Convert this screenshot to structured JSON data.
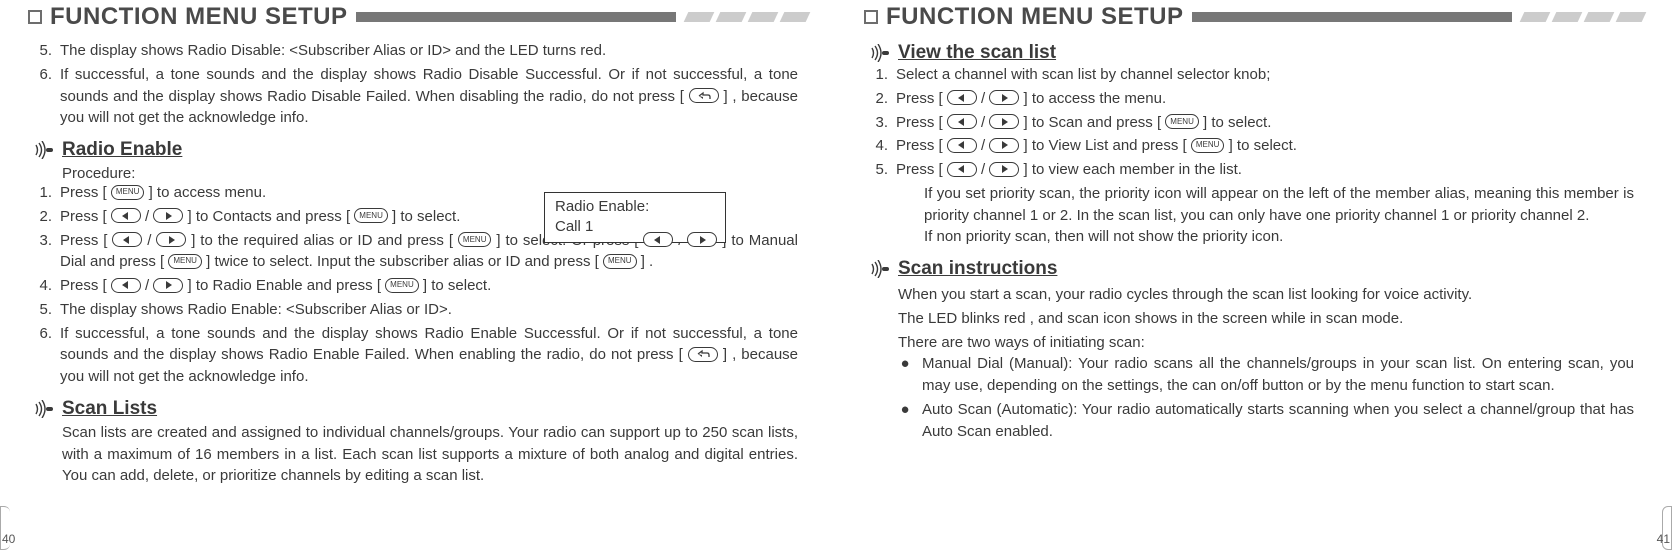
{
  "left": {
    "header_title": "FUNCTION MENU SETUP",
    "intro_items": [
      "The display shows Radio Disable: <Subscriber Alias or ID> and the LED turns red.",
      "If successful, a tone sounds and the display shows Radio Disable Successful. Or if not successful, a tone sounds and the display shows Radio Disable Failed. When disabling the radio, do not press [ {BACK} ] , because you will not get the acknowledge info."
    ],
    "intro_start": 5,
    "section1_title": "Radio Enable",
    "procedure_label": "Procedure:",
    "callout_line1": "Radio Enable:",
    "callout_line2": "Call 1",
    "proc_items": [
      "Press [ {MENU} ] to access menu.",
      "Press [ {LEFT} / {RIGHT} ] to Contacts and press [ {MENU} ]  to select.",
      "Press [ {LEFT} / {RIGHT} ] to the required alias or ID and press [ {MENU} ]  to select. Or press [ {LEFT} / {RIGHT} ] to Manual Dial and press [ {MENU} ] twice to select. Input  the subscriber alias or ID and press [ {MENU} ] .",
      "Press [ {LEFT} / {RIGHT} ] to Radio Enable and press [ {MENU} ] to select.",
      "The display shows Radio Enable: <Subscriber Alias or ID>.",
      "If successful, a tone sounds and the display shows Radio Enable Successful. Or if not successful, a tone sounds and the display shows Radio Enable Failed. When enabling the radio, do not press [ {BACK} ] , because you will not get the acknowledge info."
    ],
    "section2_title": "Scan Lists",
    "scan_lists_para": "Scan lists are created and assigned to individual channels/groups. Your radio can support up to 250 scan lists, with a maximum of 16 members in a list. Each scan list supports a mixture of both analog and digital entries. You can add, delete, or prioritize channels by editing a scan list.",
    "page_num": "40"
  },
  "right": {
    "header_title": "FUNCTION MENU SETUP",
    "section1_title": "View the scan list",
    "view_items": [
      "Select a channel with scan list by channel selector knob;",
      "Press [ {LEFT} / {RIGHT} ] to access the menu.",
      "Press [ {LEFT} / {RIGHT} ] to Scan and press [ {MENU} ] to select.",
      "Press [ {LEFT} / {RIGHT} ] to View List and press [ {MENU} ] to select.",
      "Press [ {LEFT} / {RIGHT} ] to view each member in the list."
    ],
    "view_tail1": "If you set  priority scan, the priority icon will appear on the left of the member alias, meaning this member is priority channel 1 or 2. In the scan list, you can only have one priority channel 1 or priority channel 2.",
    "view_tail2": "If non priority scan, then will not show the priority icon.",
    "section2_title": "Scan instructions",
    "scan_p1": "When you start a scan, your radio cycles through the scan list looking for voice activity.",
    "scan_p2": "The LED blinks red , and scan icon shows in the screen while in scan mode.",
    "scan_p3": "There are two ways of initiating scan:",
    "bullets": [
      "Manual Dial (Manual): Your radio scans all the channels/groups in your scan list. On entering scan, you may use, depending on the settings, the can on/off button or                            by the menu function to start scan.",
      "Auto Scan (Automatic): Your radio automatically starts scanning when you select a channel/group that has Auto Scan enabled."
    ],
    "page_num": "41"
  }
}
